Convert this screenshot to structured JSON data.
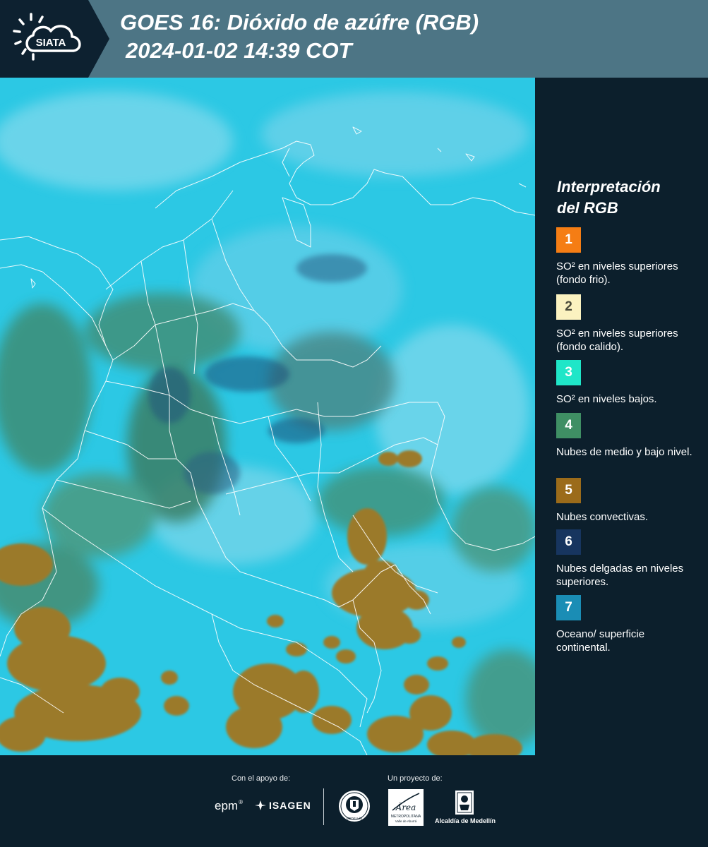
{
  "header": {
    "title": "GOES 16: Dióxido de azúfre (RGB)",
    "datetime": "2024-01-02 14:39 COT",
    "logo_text": "SIATA"
  },
  "legend": {
    "title_line1": "Interpretación",
    "title_line2": "del RGB",
    "items": [
      {
        "number": "1",
        "color": "#f57d14",
        "label": "SO² en niveles superiores (fondo frio)."
      },
      {
        "number": "2",
        "color": "#fbf2c0",
        "label": "SO² en niveles superiores (fondo calido)."
      },
      {
        "number": "3",
        "color": "#1fe6c8",
        "label": "SO² en niveles bajos."
      },
      {
        "number": "4",
        "color": "#3f8f64",
        "label": "Nubes de medio y bajo nivel."
      },
      {
        "number": "5",
        "color": "#9b6b1a",
        "label": "Nubes convectivas."
      },
      {
        "number": "6",
        "color": "#17355f",
        "label": "Nubes delgadas en niveles superiores."
      },
      {
        "number": "7",
        "color": "#1a8db5",
        "label": "Oceano/ superficie continental."
      }
    ]
  },
  "footer": {
    "support_label": "Con el apoyo de:",
    "project_label": "Un proyecto de:",
    "sponsor1": "epm",
    "sponsor2": "ISAGEN",
    "logo_area_text": "Área",
    "logo_area_sub": "METROPOLITANA",
    "logo_area_sub2": "Valle de Aburrá",
    "logo_alcaldia": "Alcaldía de Medellín",
    "logo_medellin_ring": "MEDELLÍN"
  },
  "map": {
    "colors": {
      "surface": "#29c9e6",
      "surface_light": "#8fdfee",
      "mid_clouds": "#3e8a70",
      "convective": "#9a7a2f",
      "thin_high": "#2a5f86",
      "borders": "#ffffff"
    }
  }
}
